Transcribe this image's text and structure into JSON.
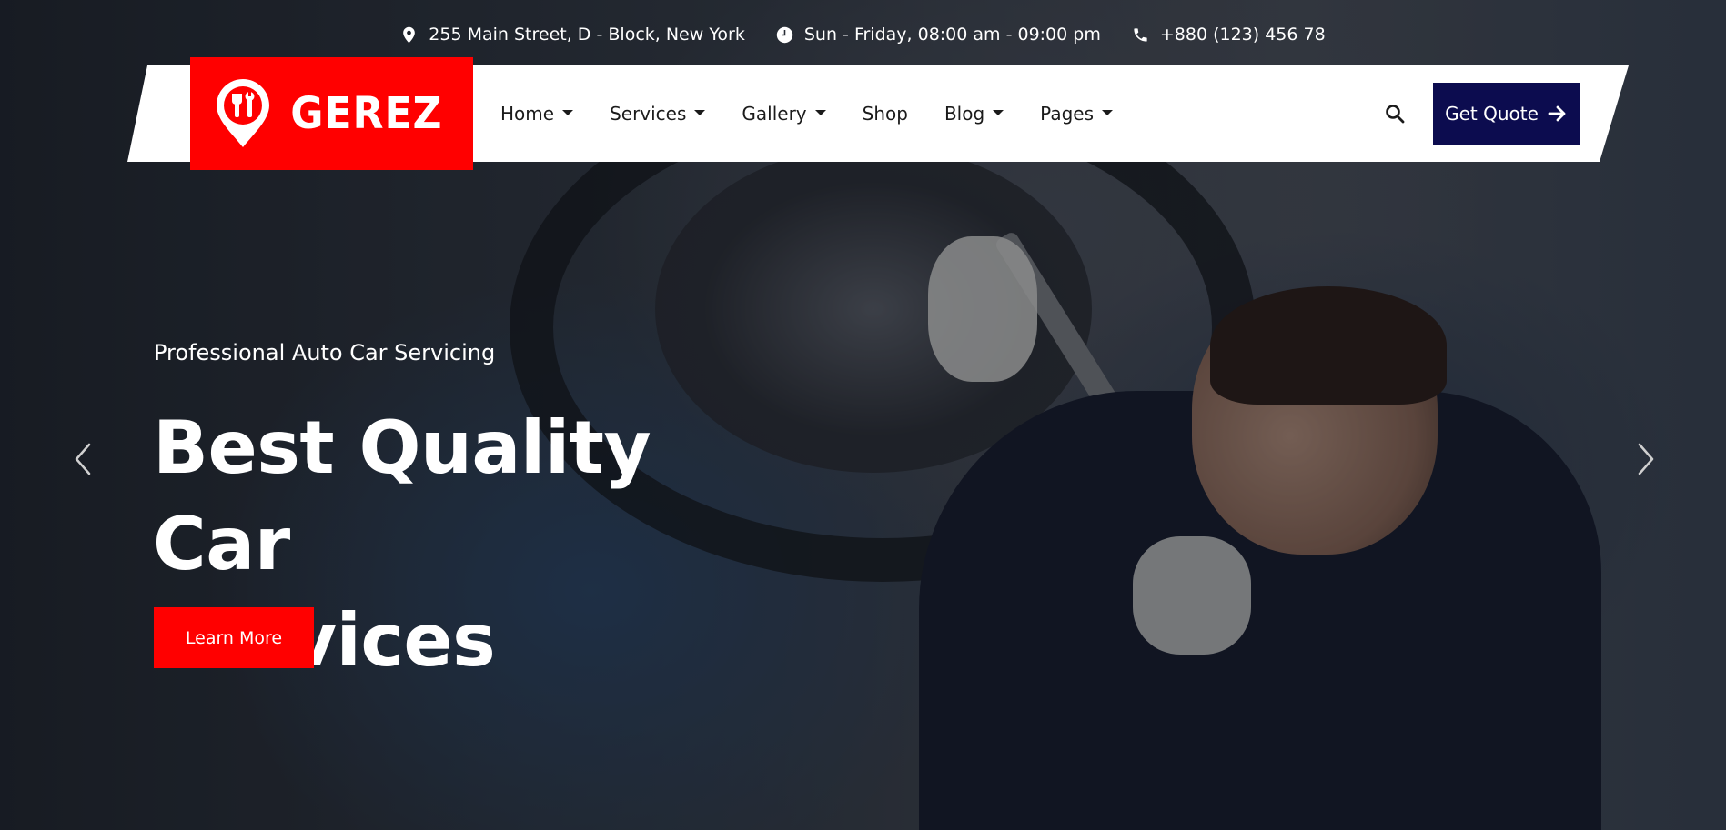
{
  "topbar": {
    "address": "255 Main Street, D - Block, New York",
    "hours": "Sun - Friday, 08:00 am - 09:00 pm",
    "phone": "+880 (123) 456 78"
  },
  "brand": {
    "name": "GEREZ",
    "accent_color": "#ff0000",
    "dark_color": "#0c0c4f"
  },
  "nav": {
    "items": [
      {
        "label": "Home",
        "dropdown": true
      },
      {
        "label": "Services",
        "dropdown": true
      },
      {
        "label": "Gallery",
        "dropdown": true
      },
      {
        "label": "Shop",
        "dropdown": false
      },
      {
        "label": "Blog",
        "dropdown": true
      },
      {
        "label": "Pages",
        "dropdown": true
      }
    ],
    "search_icon": "search-icon",
    "quote_label": "Get Quote"
  },
  "hero": {
    "subtitle": "Professional Auto Car Servicing",
    "headline_line1": "Best Quality Car",
    "headline_line2": "Services",
    "cta_label": "Learn More"
  }
}
